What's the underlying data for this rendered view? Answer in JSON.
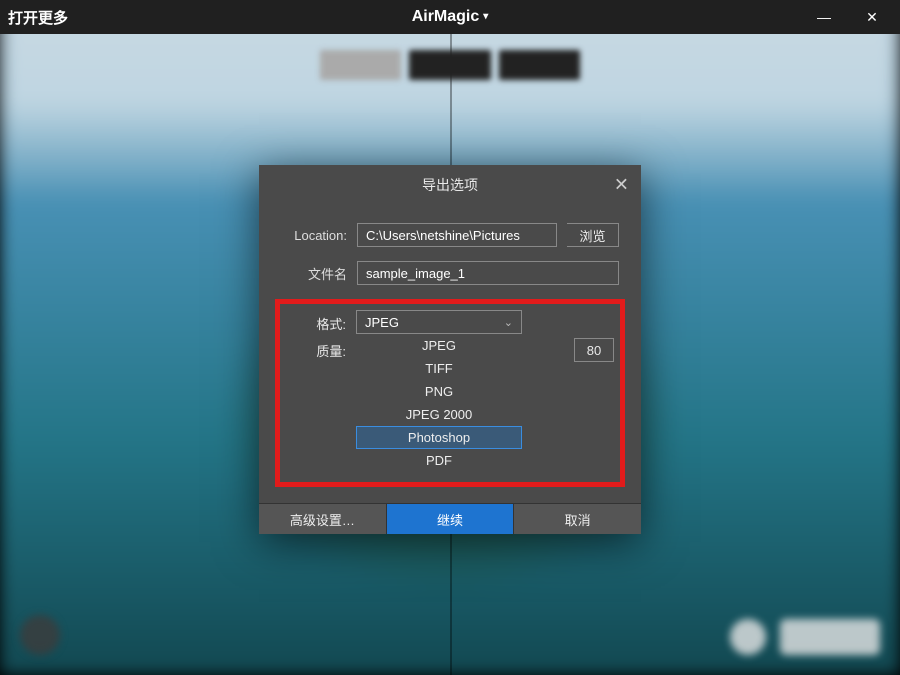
{
  "titlebar": {
    "open_more": "打开更多",
    "app_name": "AirMagic"
  },
  "modal": {
    "title": "导出选项",
    "location_label": "Location:",
    "location_value": "C:\\Users\\netshine\\Pictures",
    "browse_label": "浏览",
    "filename_label": "文件名",
    "filename_value": "sample_image_1",
    "format_label": "格式:",
    "format_selected": "JPEG",
    "format_options": [
      "JPEG",
      "TIFF",
      "PNG",
      "JPEG 2000",
      "Photoshop",
      "PDF"
    ],
    "format_highlighted_index": 4,
    "quality_label": "质量:",
    "quality_value": "80",
    "advanced_label": "高级设置…",
    "continue_label": "继续",
    "cancel_label": "取消"
  }
}
